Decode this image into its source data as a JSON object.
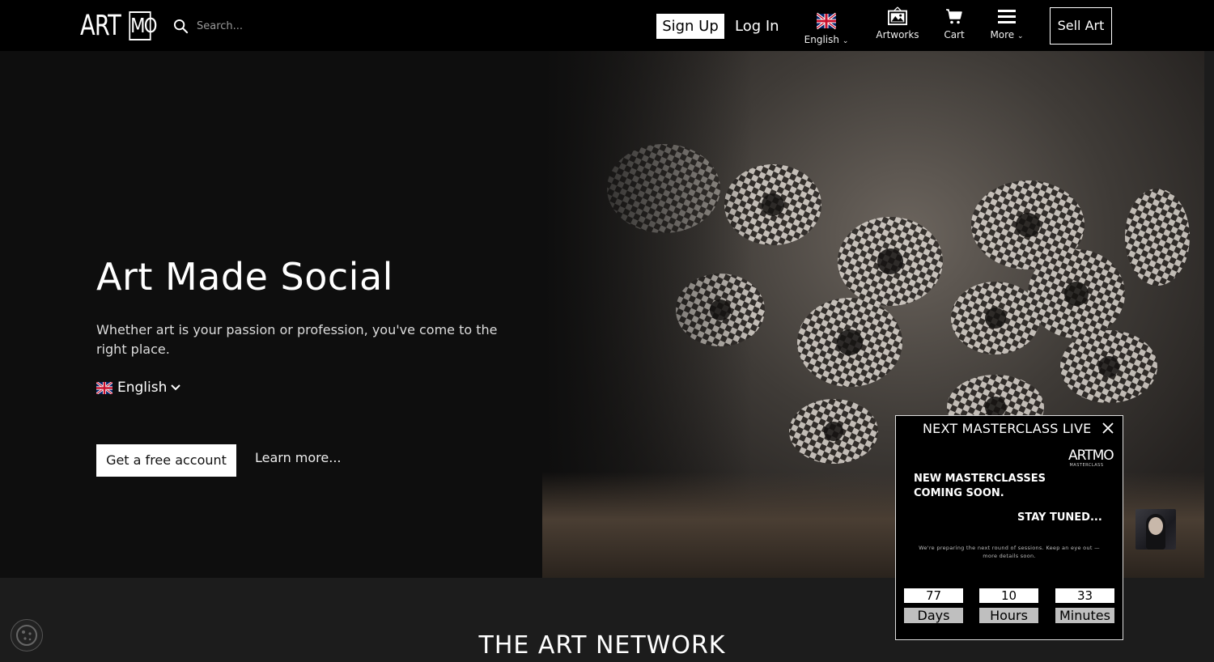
{
  "nav": {
    "logo_left": "ART",
    "logo_right": "MO",
    "search_placeholder": "Search...",
    "signup_label": "Sign Up",
    "login_label": "Log In",
    "language_label": "English",
    "artworks_label": "Artworks",
    "cart_label": "Cart",
    "more_label": "More",
    "sell_label": "Sell Art"
  },
  "hero": {
    "title": "Art Made Social",
    "subtitle": "Whether art is your passion or profession, you've come to the right place.",
    "language": "English",
    "cta_free": "Get a free account",
    "cta_learn": "Learn more..."
  },
  "section": {
    "title": "THE ART NETWORK"
  },
  "masterclass": {
    "title": "NEXT MASTERCLASS LIVE",
    "logo_text": "ARTMO",
    "logo_sub": "MASTERCLASS",
    "headline": "NEW MASTERCLASSES COMING SOON.",
    "stay_tuned": "STAY TUNED...",
    "note": "We're preparing the next round of sessions. Keep an eye out — more details soon.",
    "countdown": [
      {
        "value": "77",
        "unit": "Days"
      },
      {
        "value": "10",
        "unit": "Hours"
      },
      {
        "value": "33",
        "unit": "Minutes"
      }
    ]
  },
  "icons": {
    "search": "search-icon",
    "flag": "uk-flag-icon",
    "artworks": "artworks-icon",
    "cart": "cart-icon",
    "more": "hamburger-menu-icon",
    "close": "close-icon",
    "cookie": "cookie-icon"
  },
  "colors": {
    "nav_bg": "#000000",
    "hero_bg": "#0e0e0e",
    "page_bg": "#1c1c1c",
    "accent": "#ffffff"
  }
}
